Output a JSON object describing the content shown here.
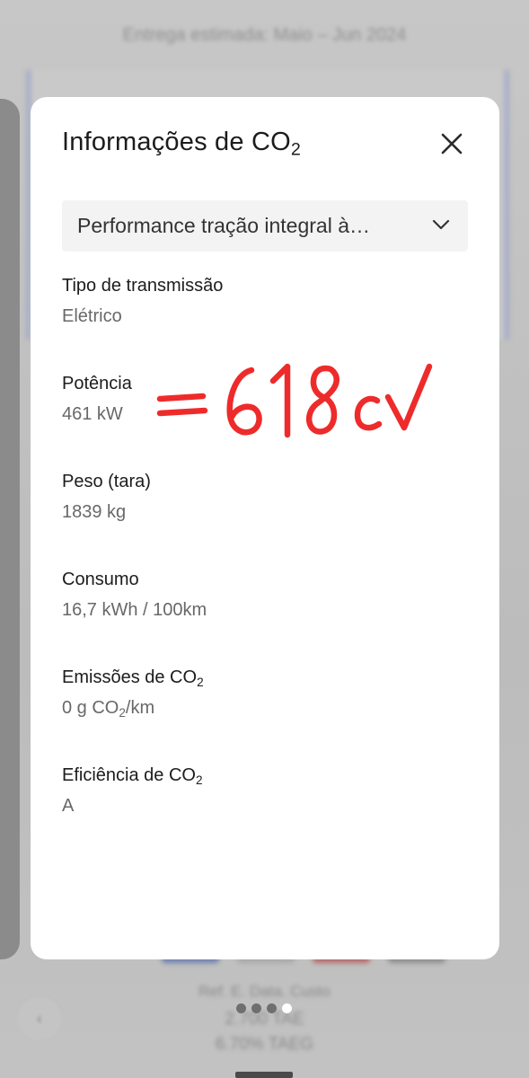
{
  "background": {
    "header_text": "Entrega estimada: Maio – Jun 2024",
    "footer_line1": "Ref. E. Data. Custo",
    "footer_line2": "2.700 TAE",
    "footer_line3": "6.70% TAEG",
    "pager": {
      "count": 4,
      "active_index": 3
    }
  },
  "modal": {
    "title_prefix": "Informações de CO",
    "title_sub": "2",
    "close_icon": "close-icon",
    "model_select": {
      "selected": "Performance tração integral à…",
      "icon": "chevron-down-icon"
    },
    "specs": {
      "transmission": {
        "label": "Tipo de transmissão",
        "value": "Elétrico"
      },
      "power": {
        "label": "Potência",
        "value": "461 kW"
      },
      "weight": {
        "label": "Peso (tara)",
        "value": "1839 kg"
      },
      "consumption": {
        "label": "Consumo",
        "value": "16,7 kWh / 100km"
      },
      "emissions": {
        "label_prefix": "Emissões de CO",
        "label_sub": "2",
        "value_prefix": "0 g CO",
        "value_sub": "2",
        "value_suffix": "/km"
      },
      "efficiency": {
        "label_prefix": "Eficiência de CO",
        "label_sub": "2",
        "value": "A"
      }
    }
  },
  "annotation": {
    "text": "=618cv",
    "color": "#ee2b2b"
  },
  "colors": {
    "modal_bg": "#ffffff",
    "overlay": "#bdbdbd",
    "select_bg": "#f3f3f3",
    "label_text": "#1c1c1c",
    "value_text": "#686868"
  }
}
